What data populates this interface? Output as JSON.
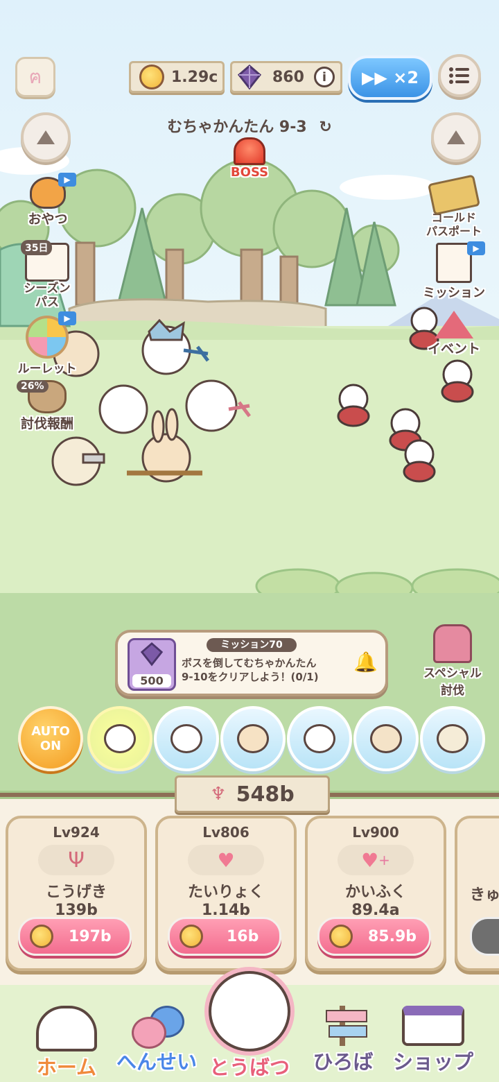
{
  "top_bar": {
    "coins": "1.29c",
    "gems": "860",
    "speed": "▶▶ ×2",
    "info_icon": "info-icon",
    "menu_icon": "menu-icon"
  },
  "stage": {
    "title": "むちゃかんたん 9-3",
    "boss_label": "BOSS"
  },
  "left_menu": [
    {
      "label": "おやつ"
    },
    {
      "label": "シーズン\nパス",
      "badge": "35日"
    },
    {
      "label": "ルーレット"
    },
    {
      "label": "討伐報酬",
      "badge": "26%"
    }
  ],
  "right_menu": [
    {
      "label": "ゴールド\nパスポート"
    },
    {
      "label": "ミッション"
    },
    {
      "label": "イベント"
    }
  ],
  "mission": {
    "title": "ミッション70",
    "reward": "500",
    "text_line1": "ボスを倒してむちゃかんたん",
    "text_line2": "9-10をクリアしよう！(0/1)"
  },
  "special": {
    "label_line1": "スペシャル",
    "label_line2": "討伐"
  },
  "auto": {
    "line1": "AUTO",
    "line2": "ON"
  },
  "power": "548b",
  "upgrades": [
    {
      "level": "Lv924",
      "name": "こうげき",
      "value": "139b",
      "price": "197b"
    },
    {
      "level": "Lv806",
      "name": "たいりょく",
      "value": "1.14b",
      "price": "16b"
    },
    {
      "level": "Lv900",
      "name": "かいふく",
      "value": "89.4a",
      "price": "85.9b"
    },
    {
      "level": "",
      "name": "きゅ"
    }
  ],
  "nav": [
    {
      "label": "ホーム",
      "color": "#f08a3c"
    },
    {
      "label": "へんせい",
      "color": "#4a86e8"
    },
    {
      "label": "とうばつ",
      "color": "#e8607a"
    },
    {
      "label": "ひろば",
      "color": "#6b5a8c"
    },
    {
      "label": "ショップ",
      "color": "#6b5a8c"
    }
  ]
}
